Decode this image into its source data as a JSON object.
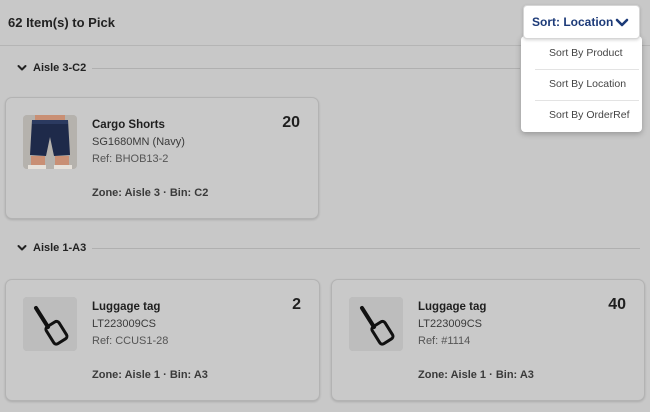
{
  "header": {
    "title": "62 Item(s) to Pick",
    "sort_button_label": "Sort: Location"
  },
  "sort_menu": {
    "options": [
      "Sort By Product",
      "Sort By Location",
      "Sort By OrderRef"
    ]
  },
  "groups": [
    {
      "label": "Aisle 3-C2",
      "items": [
        {
          "name": "Cargo Shorts",
          "sku": "SG1680MN (Navy)",
          "ref": "Ref: BHOB13-2",
          "quantity": "20",
          "location": "Zone: Aisle 3 · Bin: C2",
          "image": "navy-cargo-shorts-photo"
        }
      ]
    },
    {
      "label": "Aisle 1-A3",
      "items": [
        {
          "name": "Luggage tag",
          "sku": "LT223009CS",
          "ref": "Ref: CCUS1-28",
          "quantity": "2",
          "location": "Zone: Aisle 1 · Bin: A3",
          "image": "luggage-tag-icon"
        },
        {
          "name": "Luggage tag",
          "sku": "LT223009CS",
          "ref": "Ref: #1114",
          "quantity": "40",
          "location": "Zone: Aisle 1 · Bin: A3",
          "image": "luggage-tag-icon"
        }
      ]
    }
  ],
  "colors": {
    "accent": "#1c3a78",
    "overlay_background": "#c8c8c8",
    "menu_background": "#ffffff"
  }
}
